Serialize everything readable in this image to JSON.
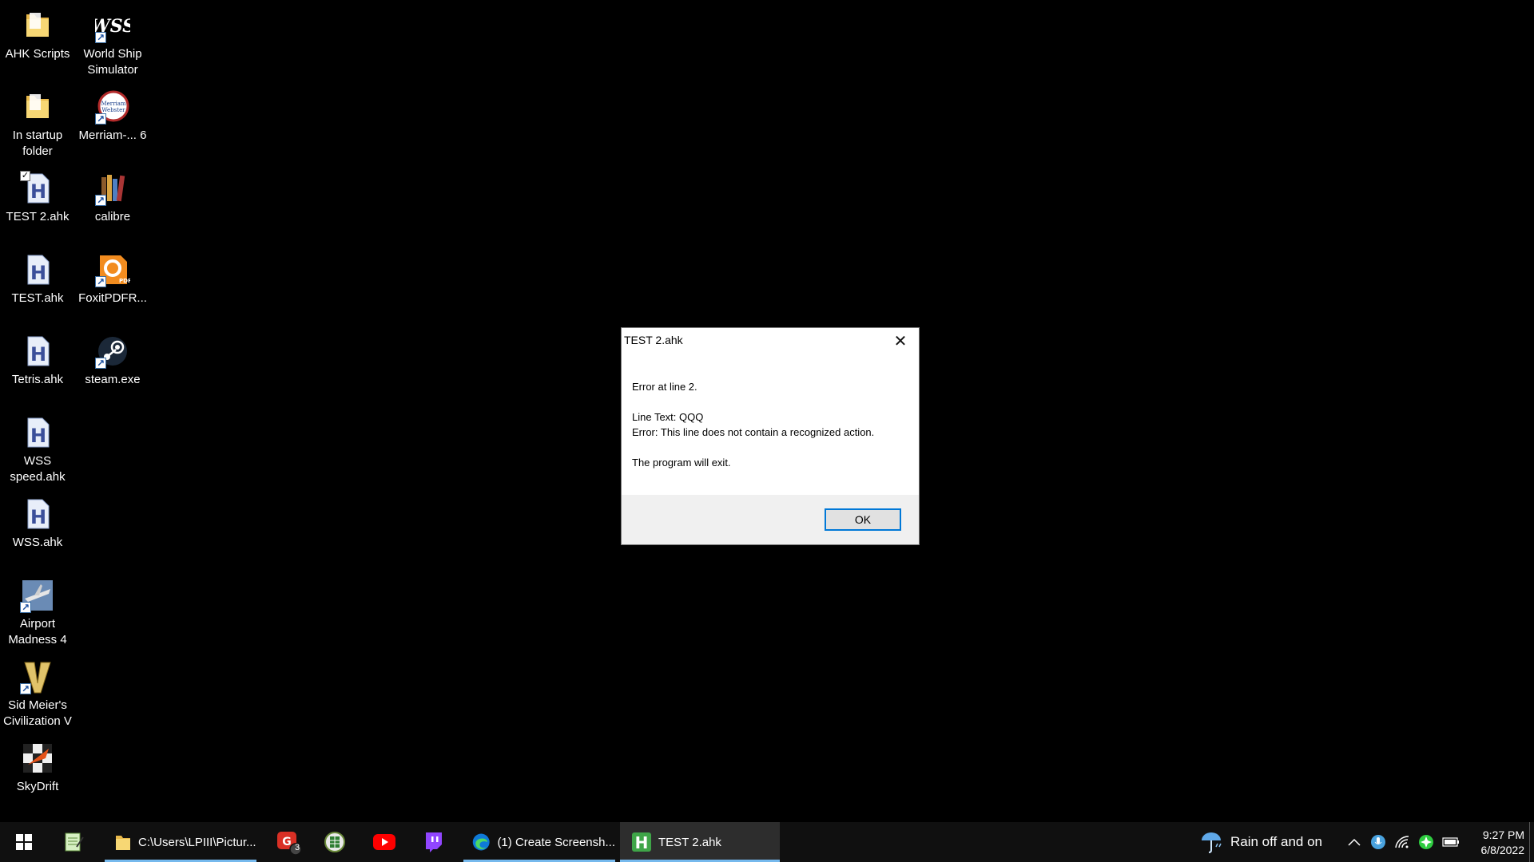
{
  "desktop": {
    "icons": [
      {
        "label": "AHK Scripts",
        "icon": "folder-icon"
      },
      {
        "label": "World Ship Simulator",
        "icon": "wss-app-icon"
      },
      {
        "label": "In startup folder",
        "icon": "folder-icon"
      },
      {
        "label": "Merriam-... 6",
        "icon": "merriam-webster-icon"
      },
      {
        "label": "TEST 2.ahk",
        "icon": "ahk-file-icon"
      },
      {
        "label": "calibre",
        "icon": "calibre-icon"
      },
      {
        "label": "TEST.ahk",
        "icon": "ahk-file-icon"
      },
      {
        "label": "FoxitPDFR...",
        "icon": "foxit-pdf-icon"
      },
      {
        "label": "Tetris.ahk",
        "icon": "ahk-file-icon"
      },
      {
        "label": "steam.exe",
        "icon": "steam-icon"
      },
      {
        "label": "WSS speed.ahk",
        "icon": "ahk-file-icon"
      },
      {
        "label": "WSS.ahk",
        "icon": "ahk-file-icon"
      },
      {
        "label": "Airport Madness 4",
        "icon": "airport-madness-icon"
      },
      {
        "label": "Sid Meier's Civilization V",
        "icon": "civilization-icon"
      },
      {
        "label": "SkyDrift",
        "icon": "skydrift-icon"
      }
    ]
  },
  "dialog": {
    "title": "TEST 2.ahk",
    "close_glyph": "✕",
    "line1": "Error at line 2.",
    "line2": "Line Text: QQQ",
    "line3": "Error: This line does not contain a recognized action.",
    "line4": "The program will exit.",
    "ok_label": "OK"
  },
  "taskbar": {
    "explorer_label": "C:\\Users\\LPIII\\Pictur...",
    "gmail_badge": "3",
    "edge_label": "(1) Create Screensh...",
    "ahk_label": "TEST 2.ahk",
    "weather_text": "Rain off and on",
    "time": "9:27 PM",
    "date": "6/8/2022"
  },
  "colors": {
    "accent": "#0078d7",
    "taskbar_underline": "#76b9ed"
  }
}
